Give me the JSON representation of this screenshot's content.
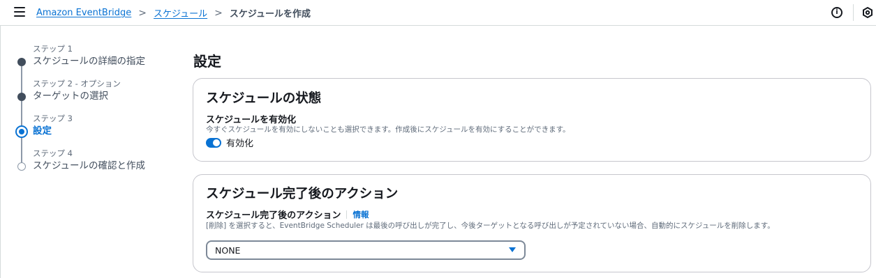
{
  "breadcrumb": {
    "items": [
      "Amazon EventBridge",
      "スケジュール"
    ],
    "current": "スケジュールを作成",
    "separator": ">"
  },
  "header": {
    "info_icon": "info-circle-icon",
    "settings_icon": "settings-icon"
  },
  "steps": [
    {
      "num": "ステップ 1",
      "title": "スケジュールの詳細の指定",
      "state": "complete"
    },
    {
      "num": "ステップ 2 - オプション",
      "title": "ターゲットの選択",
      "state": "complete"
    },
    {
      "num": "ステップ 3",
      "title": "設定",
      "state": "current"
    },
    {
      "num": "ステップ 4",
      "title": "スケジュールの確認と作成",
      "state": "pending"
    }
  ],
  "main": {
    "title": "設定",
    "state_card": {
      "title": "スケジュールの状態",
      "field_label": "スケジュールを有効化",
      "description": "今すぐスケジュールを有効にしないことも選択できます。作成後にスケジュールを有効にすることができます。",
      "toggle_label": "有効化",
      "toggle_on": true
    },
    "action_card": {
      "title": "スケジュール完了後のアクション",
      "field_label": "スケジュール完了後のアクション",
      "info_link": "情報",
      "description": "[削除] を選択すると、EventBridge Scheduler は最後の呼び出しが完了し、今後ターゲットとなる呼び出しが予定されていない場合、自動的にスケジュールを削除します。",
      "select_value": "NONE"
    }
  },
  "colors": {
    "accent": "#0972d3",
    "text": "#16191f",
    "muted": "#5f6b7a",
    "border": "#c6c6cd"
  }
}
